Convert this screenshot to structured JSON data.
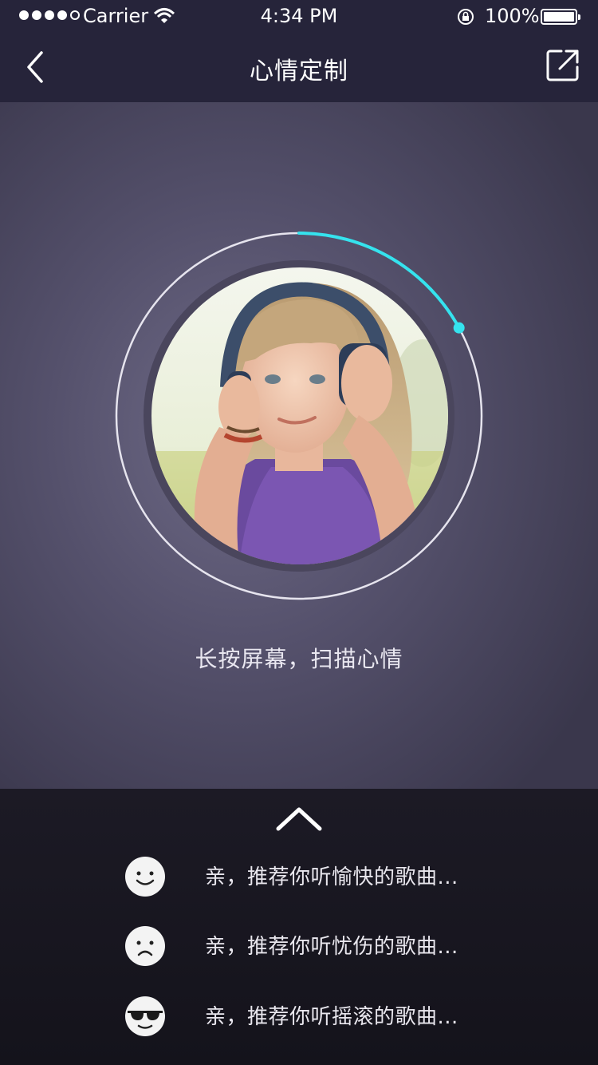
{
  "status_bar": {
    "carrier": "Carrier",
    "time": "4:34 PM",
    "battery": "100%"
  },
  "navbar": {
    "title": "心情定制",
    "back_icon": "chevron-left-icon",
    "share_icon": "share-external-icon"
  },
  "scanner": {
    "progress": 0.17,
    "accent_color": "#35e3ee",
    "hint": "长按屏幕，扫描心情"
  },
  "drawer": {
    "handle_icon": "chevron-up-icon",
    "moods": [
      {
        "icon": "happy-face-icon",
        "label": "亲，推荐你听愉快的歌曲..."
      },
      {
        "icon": "sad-face-icon",
        "label": "亲，推荐你听忧伤的歌曲..."
      },
      {
        "icon": "sunglasses-face-icon",
        "label": "亲，推荐你听摇滚的歌曲..."
      }
    ]
  }
}
